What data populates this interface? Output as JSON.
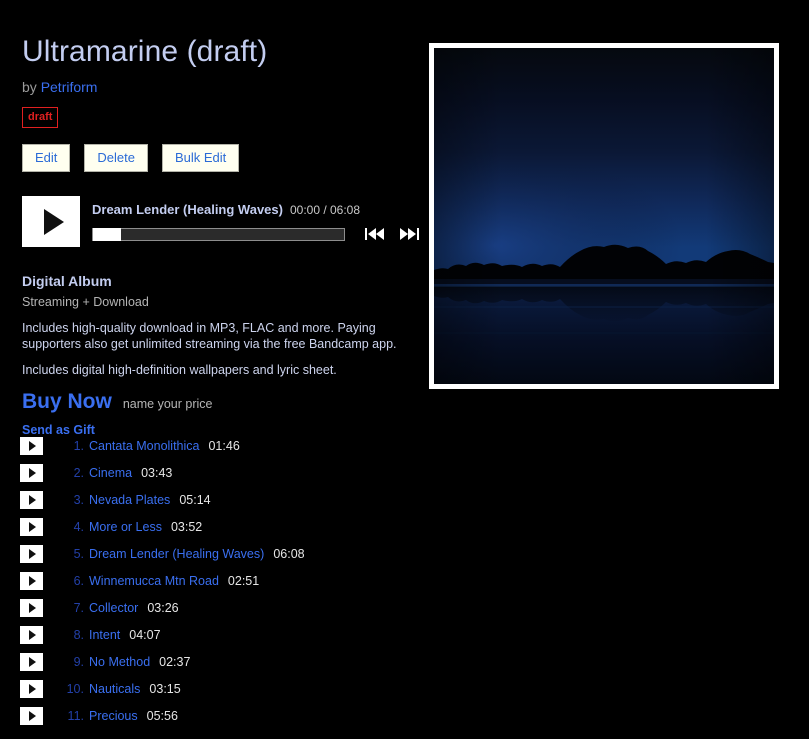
{
  "album": {
    "title": "Ultramarine (draft)",
    "by_prefix": "by",
    "artist": "Petriform",
    "status_badge": "draft"
  },
  "actions": {
    "edit": "Edit",
    "delete": "Delete",
    "bulk_edit": "Bulk Edit"
  },
  "player": {
    "play_icon": "play-icon",
    "prev_icon": "skip-previous-icon",
    "next_icon": "skip-next-icon",
    "now_playing_title": "Dream Lender (Healing Waves)",
    "time_display": "00:00 / 06:08",
    "elapsed": "00:00",
    "duration": "06:08",
    "progress_percent": 0
  },
  "purchase": {
    "heading": "Digital Album",
    "subheading": "Streaming + Download",
    "description_1": "Includes high-quality download in MP3, FLAC and more. Paying supporters also get unlimited streaming via the free Bandcamp app.",
    "description_2": "Includes digital high-definition wallpapers and lyric sheet.",
    "buy_now": "Buy Now",
    "price_note": "name your price",
    "send_as_gift": "Send as Gift"
  },
  "album_art": {
    "name": "album-cover-art",
    "description": "Night photograph of a lake at dusk with dark tree silhouettes reflected in still water",
    "sky_top_color": "#060b18",
    "sky_mid_color": "#0c1c42",
    "horizon_glow_color": "#12336b",
    "tree_color": "#020306",
    "water_color": "#050f26"
  },
  "colors": {
    "background": "#000000",
    "title": "#c3cdf0",
    "link_blue": "#3a6ff0",
    "track_number": "#2340a8",
    "badge_red": "#e02020",
    "button_bg": "#fffff0",
    "muted_gray": "#b4b4b4"
  },
  "tracks": [
    {
      "num": "1.",
      "title": "Cantata Monolithica",
      "duration": "01:46"
    },
    {
      "num": "2.",
      "title": "Cinema",
      "duration": "03:43"
    },
    {
      "num": "3.",
      "title": "Nevada Plates",
      "duration": "05:14"
    },
    {
      "num": "4.",
      "title": "More or Less",
      "duration": "03:52"
    },
    {
      "num": "5.",
      "title": "Dream Lender (Healing Waves)",
      "duration": "06:08"
    },
    {
      "num": "6.",
      "title": "Winnemucca Mtn Road",
      "duration": "02:51"
    },
    {
      "num": "7.",
      "title": "Collector",
      "duration": "03:26"
    },
    {
      "num": "8.",
      "title": "Intent",
      "duration": "04:07"
    },
    {
      "num": "9.",
      "title": "No Method",
      "duration": "02:37"
    },
    {
      "num": "10.",
      "title": "Nauticals",
      "duration": "03:15"
    },
    {
      "num": "11.",
      "title": "Precious",
      "duration": "05:56"
    }
  ]
}
